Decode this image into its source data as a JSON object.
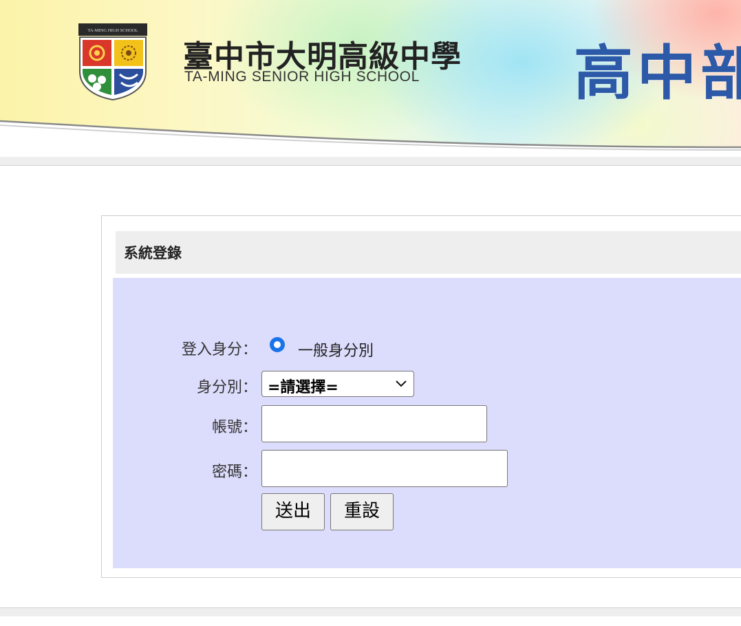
{
  "banner": {
    "school_name_zh": "臺中市大明高級中學",
    "school_name_en": "TA-MING SENIOR HIGH SCHOOL",
    "title": "高中部",
    "logo_band_text": "TA-MING HIGH SCHOOL",
    "logo_icon": "school-emblem-icon"
  },
  "login": {
    "title": "系統登錄",
    "identity_label": "登入身分：",
    "identity_option": "一般身分別",
    "role_label": "身分別：",
    "role_selected": "=請選擇=",
    "account_label": "帳號：",
    "account_value": "",
    "password_label": "密碼：",
    "password_value": "",
    "submit_label": "送出",
    "reset_label": "重設"
  },
  "colors": {
    "form_background": "#dcdcfc",
    "header_background": "#eeeeee",
    "radio_accent": "#1a73e8",
    "banner_title": "#2d5aa8"
  }
}
